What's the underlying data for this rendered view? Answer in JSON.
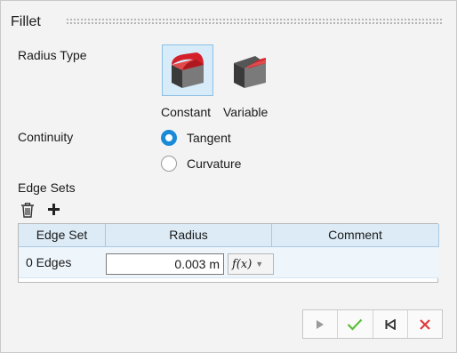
{
  "panel": {
    "title": "Fillet"
  },
  "radius_type": {
    "label": "Radius Type",
    "options": [
      {
        "label": "Constant",
        "icon": "constant-radius-icon",
        "selected": true
      },
      {
        "label": "Variable",
        "icon": "variable-radius-icon",
        "selected": false
      }
    ]
  },
  "continuity": {
    "label": "Continuity",
    "options": [
      {
        "label": "Tangent",
        "selected": true
      },
      {
        "label": "Curvature",
        "selected": false
      }
    ]
  },
  "edge_sets": {
    "label": "Edge Sets",
    "toolbar": {
      "delete_icon": "trash-icon",
      "add_icon": "plus-icon"
    },
    "columns": [
      "Edge Set",
      "Radius",
      "Comment"
    ],
    "rows": [
      {
        "edge_set": "0 Edges",
        "radius": "0.003 m",
        "function_label": "f(x)",
        "comment": ""
      }
    ]
  },
  "actions": {
    "icons": [
      "play-icon",
      "check-icon",
      "back-to-start-icon",
      "close-icon"
    ]
  },
  "colors": {
    "accent": "#1a8ad8",
    "selection_bg": "#d7ebf8",
    "header_bg": "#dcebf6",
    "check_green": "#5cbf3a",
    "close_red": "#e03a3a",
    "fillet_red": "#d4202a"
  }
}
